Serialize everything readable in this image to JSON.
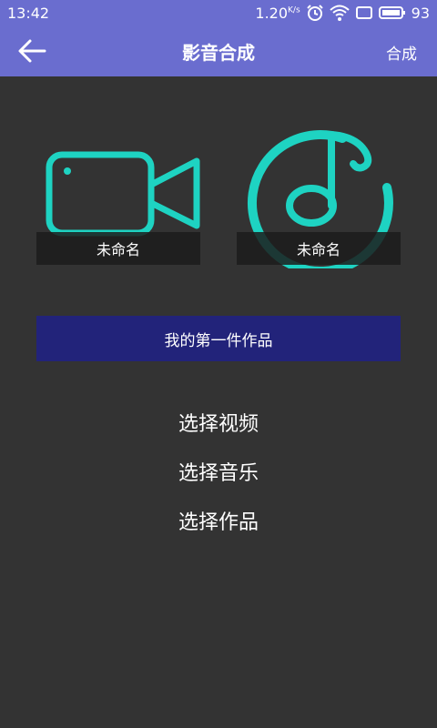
{
  "status_bar": {
    "time": "13:42",
    "speed": "1.20",
    "speed_unit": "K/s",
    "battery": "93"
  },
  "app_bar": {
    "title": "影音合成",
    "action": "合成",
    "back_icon": "arrow-left-icon"
  },
  "media": {
    "video": {
      "icon": "video-camera-icon",
      "caption": "未命名"
    },
    "audio": {
      "icon": "music-note-icon",
      "caption": "未命名"
    }
  },
  "work_title": "我的第一件作品",
  "menu": [
    {
      "label": "选择视频"
    },
    {
      "label": "选择音乐"
    },
    {
      "label": "选择作品"
    }
  ],
  "colors": {
    "primary": "#6a6dcf",
    "background": "#333333",
    "accent": "#1ed3c2",
    "title_bar": "#22237a"
  }
}
